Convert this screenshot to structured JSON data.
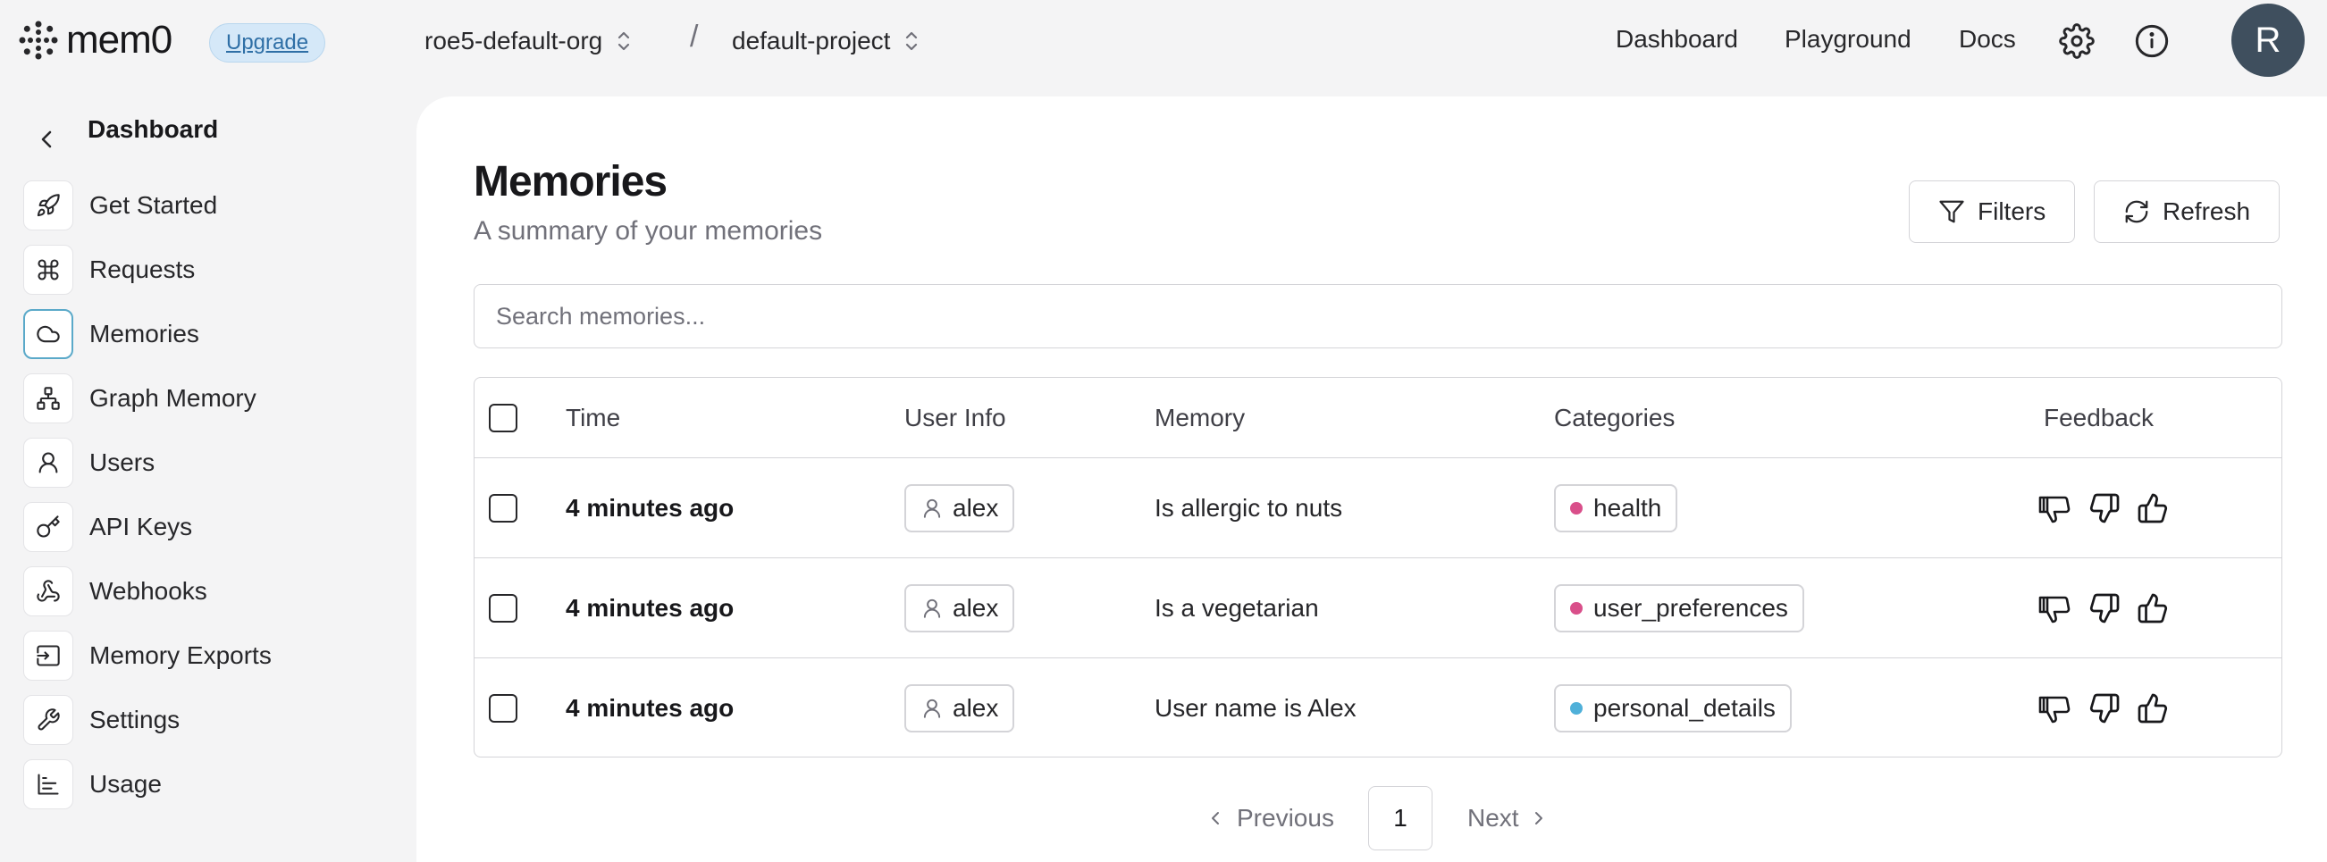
{
  "brand": {
    "name": "mem0",
    "upgrade_label": "Upgrade"
  },
  "breadcrumb": {
    "org": "roe5-default-org",
    "separator": "/",
    "project": "default-project"
  },
  "topnav": {
    "dashboard": "Dashboard",
    "playground": "Playground",
    "docs": "Docs"
  },
  "user": {
    "avatar_initial": "R"
  },
  "sidebar": {
    "back_label": "Dashboard",
    "items": [
      {
        "label": "Get Started",
        "icon": "rocket-icon"
      },
      {
        "label": "Requests",
        "icon": "command-icon"
      },
      {
        "label": "Memories",
        "icon": "cloud-icon",
        "active": true
      },
      {
        "label": "Graph Memory",
        "icon": "graph-icon"
      },
      {
        "label": "Users",
        "icon": "user-icon"
      },
      {
        "label": "API Keys",
        "icon": "key-icon"
      },
      {
        "label": "Webhooks",
        "icon": "webhook-icon"
      },
      {
        "label": "Memory Exports",
        "icon": "export-icon"
      },
      {
        "label": "Settings",
        "icon": "wrench-icon"
      },
      {
        "label": "Usage",
        "icon": "chart-icon"
      }
    ]
  },
  "main": {
    "title": "Memories",
    "subtitle": "A summary of your memories",
    "filters_label": "Filters",
    "refresh_label": "Refresh",
    "search_placeholder": "Search memories..."
  },
  "table": {
    "headers": {
      "time": "Time",
      "user_info": "User Info",
      "memory": "Memory",
      "categories": "Categories",
      "feedback": "Feedback"
    },
    "rows": [
      {
        "time": "4 minutes ago",
        "user": "alex",
        "memory": "Is allergic to nuts",
        "category": "health",
        "category_color": "#d94f8a"
      },
      {
        "time": "4 minutes ago",
        "user": "alex",
        "memory": "Is a vegetarian",
        "category": "user_preferences",
        "category_color": "#d94f8a"
      },
      {
        "time": "4 minutes ago",
        "user": "alex",
        "memory": "User name is Alex",
        "category": "personal_details",
        "category_color": "#4fb0d9"
      }
    ]
  },
  "pagination": {
    "previous": "Previous",
    "page": "1",
    "next": "Next"
  }
}
